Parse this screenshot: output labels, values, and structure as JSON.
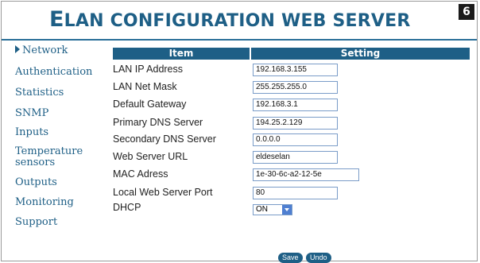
{
  "header": {
    "title_first": "E",
    "title_rest": "LAN CONFIGURATION WEB SERVER",
    "page_number": "6"
  },
  "sidebar": {
    "items": [
      {
        "label": "Network",
        "active": true
      },
      {
        "label": "Authentication"
      },
      {
        "label": "Statistics"
      },
      {
        "label": "SNMP"
      },
      {
        "label": "Inputs"
      },
      {
        "label": "Temperature sensors"
      },
      {
        "label": "Outputs"
      },
      {
        "label": "Monitoring"
      },
      {
        "label": "Support"
      }
    ]
  },
  "table": {
    "columns": [
      "Item",
      "Setting"
    ],
    "rows": [
      {
        "label": "LAN IP Address",
        "value": "192.168.3.155"
      },
      {
        "label": "LAN Net Mask",
        "value": "255.255.255.0"
      },
      {
        "label": "Default Gateway",
        "value": "192.168.3.1"
      },
      {
        "label": "Primary DNS Server",
        "value": "194.25.2.129"
      },
      {
        "label": "Secondary DNS Server",
        "value": "0.0.0.0"
      },
      {
        "label": "Web Server URL",
        "value": "eldeselan"
      },
      {
        "label": "MAC Adress",
        "value": "1e-30-6c-a2-12-5e"
      },
      {
        "label": "Local Web Server Port",
        "value": "80"
      },
      {
        "label": "DHCP",
        "value": "ON"
      }
    ]
  },
  "actions": {
    "save_label": "Save",
    "undo_label": "Undo"
  },
  "colors": {
    "accent": "#1e5f86",
    "field_border": "#7a9cc8"
  }
}
